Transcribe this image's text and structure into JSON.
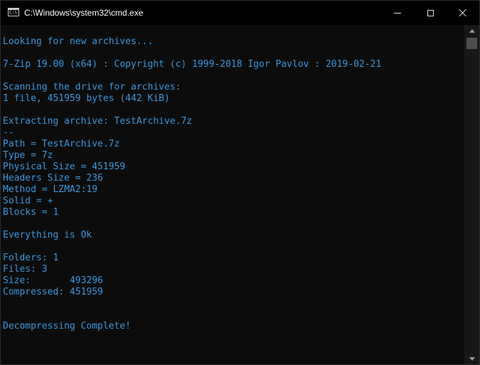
{
  "window": {
    "title": "C:\\Windows\\system32\\cmd.exe",
    "icon": "cmd-console-icon",
    "icon_text": "C:\\",
    "controls": [
      "minimize-icon",
      "maximize-icon",
      "close-icon"
    ]
  },
  "colors": {
    "console_background": "#0c0c0c",
    "console_text": "#3a96dd",
    "titlebar_background": "#000000"
  },
  "console": {
    "lines": [
      "Looking for new archives...",
      "",
      "7-Zip 19.00 (x64) : Copyright (c) 1999-2018 Igor Pavlov : 2019-02-21",
      "",
      "Scanning the drive for archives:",
      "1 file, 451959 bytes (442 KiB)",
      "",
      "Extracting archive: TestArchive.7z",
      "--",
      "Path = TestArchive.7z",
      "Type = 7z",
      "Physical Size = 451959",
      "Headers Size = 236",
      "Method = LZMA2:19",
      "Solid = +",
      "Blocks = 1",
      "",
      "Everything is Ok",
      "",
      "Folders: 1",
      "Files: 3",
      "Size:       493296",
      "Compressed: 451959",
      "",
      "",
      "Decompressing Complete!"
    ]
  }
}
